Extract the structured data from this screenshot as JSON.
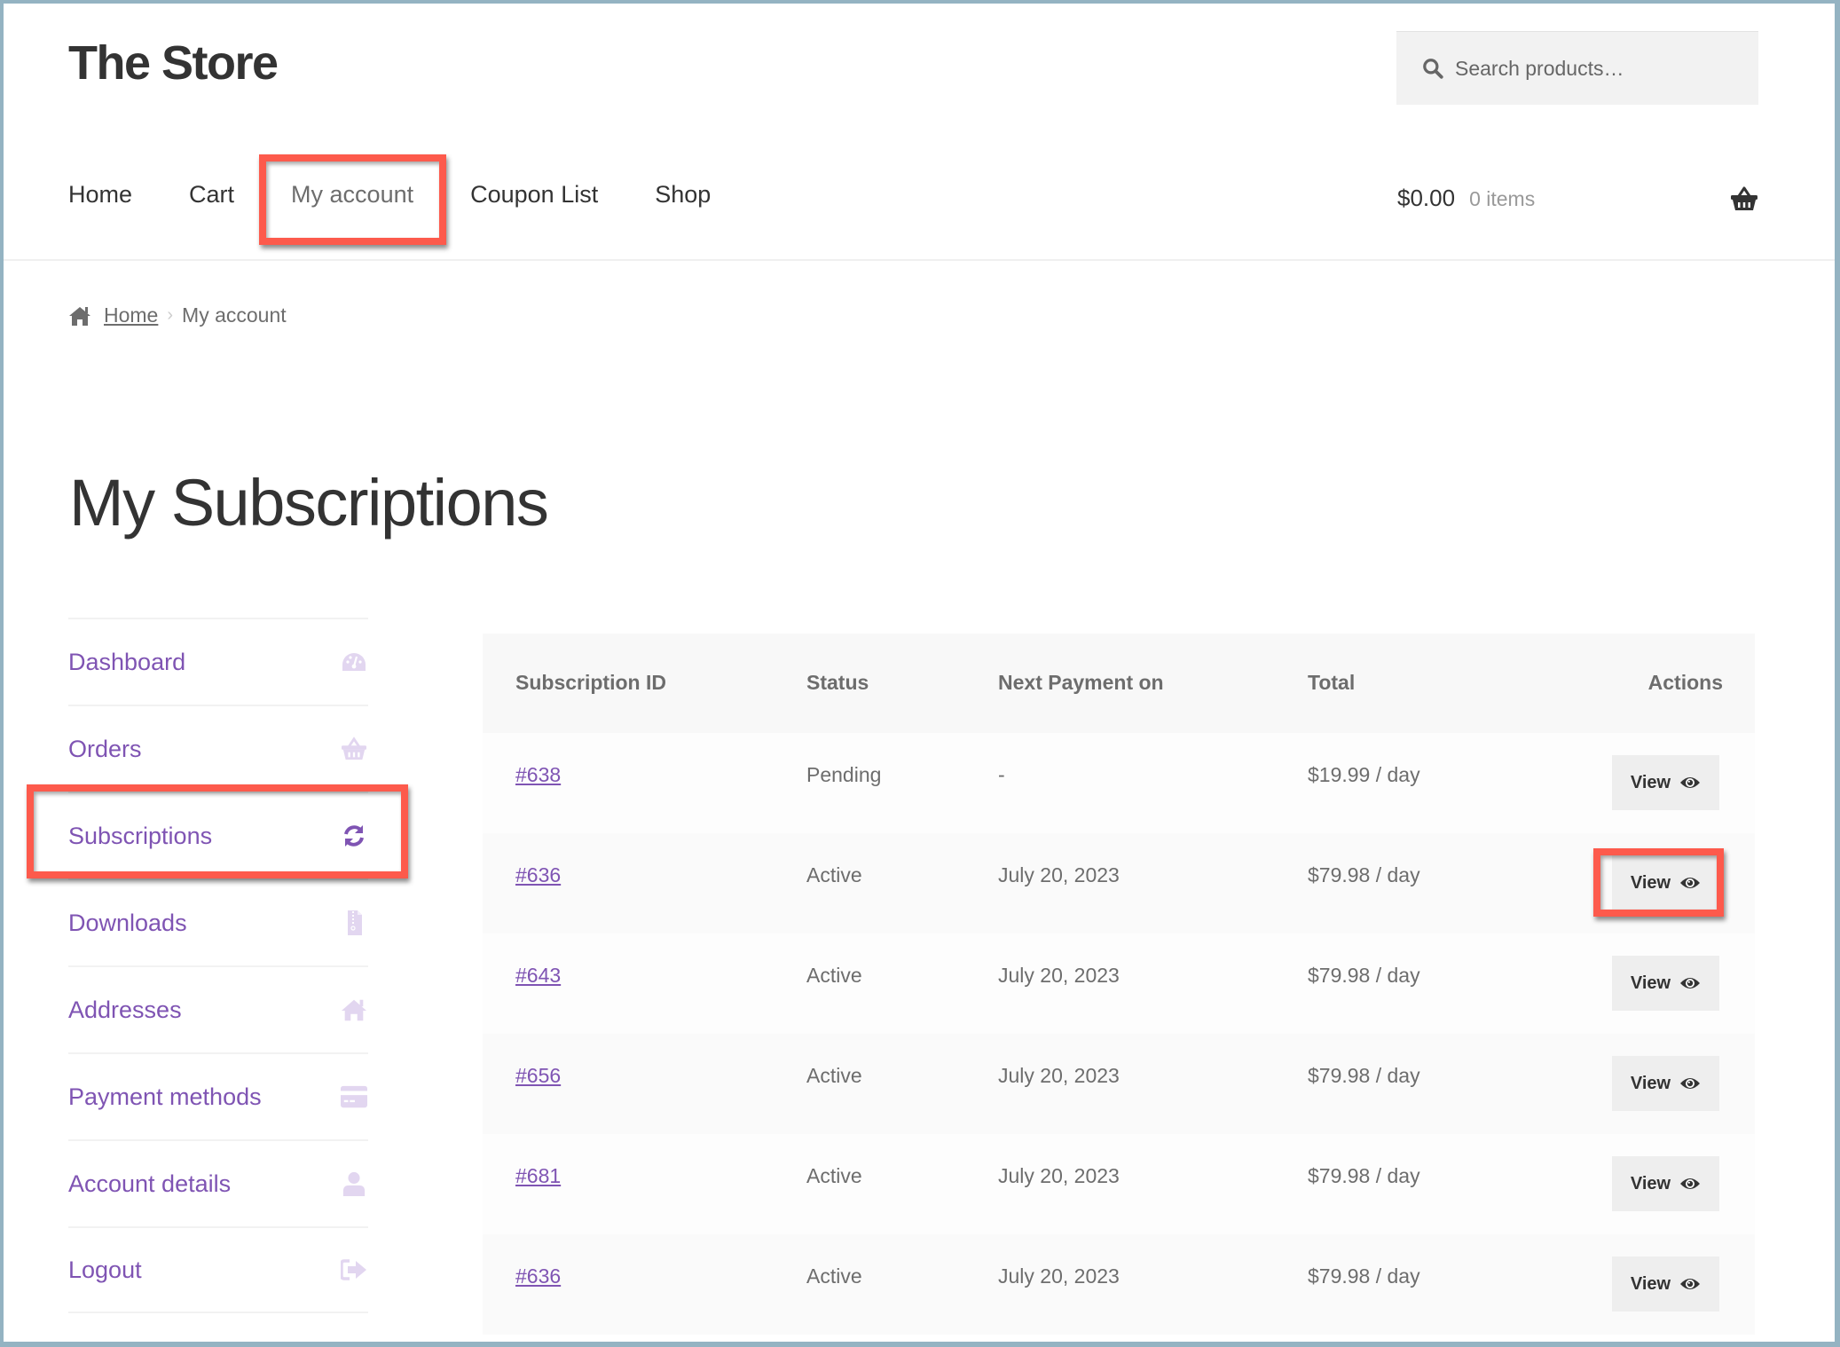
{
  "header": {
    "site_title": "The Store",
    "search": {
      "placeholder": "Search products…",
      "value": ""
    },
    "nav": [
      {
        "label": "Home",
        "current": false
      },
      {
        "label": "Cart",
        "current": false
      },
      {
        "label": "My account",
        "current": true
      },
      {
        "label": "Coupon List",
        "current": false
      },
      {
        "label": "Shop",
        "current": false
      }
    ],
    "cart": {
      "amount": "$0.00",
      "count": "0 items",
      "icon": "basket-icon"
    }
  },
  "breadcrumb": {
    "icon": "home-icon",
    "items": [
      {
        "label": "Home",
        "link": true
      },
      {
        "label": "My account",
        "link": false
      }
    ],
    "separator": "›"
  },
  "page": {
    "title": "My Subscriptions"
  },
  "sidebar": {
    "items": [
      {
        "label": "Dashboard",
        "icon": "dashboard-gauge-icon",
        "active": false
      },
      {
        "label": "Orders",
        "icon": "basket-icon",
        "active": false
      },
      {
        "label": "Subscriptions",
        "icon": "refresh-icon",
        "active": true
      },
      {
        "label": "Downloads",
        "icon": "file-archive-icon",
        "active": false
      },
      {
        "label": "Addresses",
        "icon": "home-icon",
        "active": false
      },
      {
        "label": "Payment methods",
        "icon": "credit-card-icon",
        "active": false
      },
      {
        "label": "Account details",
        "icon": "user-icon",
        "active": false
      },
      {
        "label": "Logout",
        "icon": "sign-out-icon",
        "active": false
      }
    ]
  },
  "table": {
    "headers": [
      "Subscription ID",
      "Status",
      "Next Payment on",
      "Total",
      "Actions"
    ],
    "rows": [
      {
        "id": "#638",
        "status": "Pending",
        "next_payment": "-",
        "total": "$19.99 / day",
        "action": "View"
      },
      {
        "id": "#636",
        "status": "Active",
        "next_payment": "July 20, 2023",
        "total": "$79.98 / day",
        "action": "View"
      },
      {
        "id": "#643",
        "status": "Active",
        "next_payment": "July 20, 2023",
        "total": "$79.98 / day",
        "action": "View"
      },
      {
        "id": "#656",
        "status": "Active",
        "next_payment": "July 20, 2023",
        "total": "$79.98 / day",
        "action": "View"
      },
      {
        "id": "#681",
        "status": "Active",
        "next_payment": "July 20, 2023",
        "total": "$79.98 / day",
        "action": "View"
      },
      {
        "id": "#636",
        "status": "Active",
        "next_payment": "July 20, 2023",
        "total": "$79.98 / day",
        "action": "View"
      }
    ]
  },
  "colors": {
    "accent": "#7f54b3",
    "accent_icon_inactive": "#e2d6f0",
    "highlight": "#fd5a4c",
    "frame": "#94b3c2"
  },
  "annotations": [
    {
      "target": "nav My account"
    },
    {
      "target": "sidebar Subscriptions"
    },
    {
      "target": "View button row 2"
    }
  ]
}
